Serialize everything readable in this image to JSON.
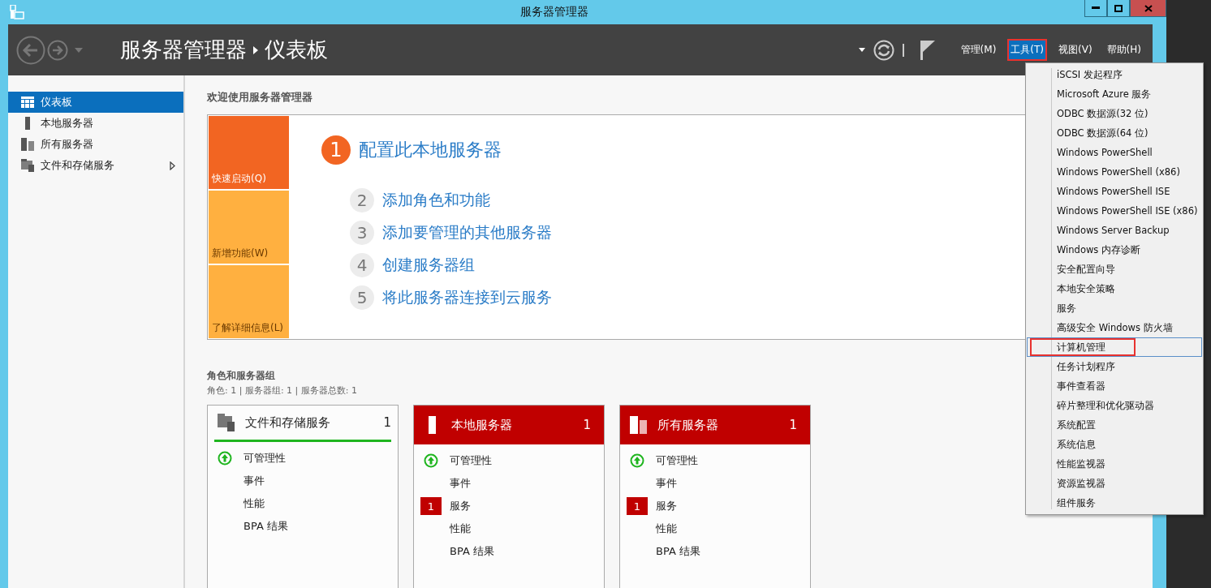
{
  "window": {
    "title": "服务器管理器"
  },
  "breadcrumb": {
    "root": "服务器管理器",
    "current": "仪表板"
  },
  "menubar": [
    {
      "label": "管理(M)",
      "selected": false,
      "annotated": false
    },
    {
      "label": "工具(T)",
      "selected": true,
      "annotated": true
    },
    {
      "label": "视图(V)",
      "selected": false,
      "annotated": false
    },
    {
      "label": "帮助(H)",
      "selected": false,
      "annotated": false
    }
  ],
  "sidebar": {
    "items": [
      {
        "label": "仪表板",
        "kind": "dashboard",
        "selected": true,
        "has_submenu": false
      },
      {
        "label": "本地服务器",
        "kind": "server",
        "selected": false,
        "has_submenu": false
      },
      {
        "label": "所有服务器",
        "kind": "servers",
        "selected": false,
        "has_submenu": false
      },
      {
        "label": "文件和存储服务",
        "kind": "files",
        "selected": false,
        "has_submenu": true
      }
    ]
  },
  "welcome": {
    "title": "欢迎使用服务器管理器",
    "tiles": [
      {
        "label": "快速启动(Q)",
        "selected": true
      },
      {
        "label": "新增功能(W)",
        "selected": false
      },
      {
        "label": "了解详细信息(L)",
        "selected": false
      }
    ],
    "steps": [
      {
        "number": "1",
        "label": "配置此本地服务器",
        "selected": true
      },
      {
        "number": "2",
        "label": "添加角色和功能",
        "selected": false
      },
      {
        "number": "3",
        "label": "添加要管理的其他服务器",
        "selected": false
      },
      {
        "number": "4",
        "label": "创建服务器组",
        "selected": false
      },
      {
        "number": "5",
        "label": "将此服务器连接到云服务",
        "selected": false
      }
    ]
  },
  "roles": {
    "title": "角色和服务器组",
    "summary": "角色: 1 | 服务器组: 1 | 服务器总数: 1",
    "cards": [
      {
        "title": "文件和存储服务",
        "count": "1",
        "kind": "files",
        "alert": false,
        "rows": [
          {
            "label": "可管理性",
            "healthy": true
          },
          {
            "label": "事件"
          },
          {
            "label": "性能"
          },
          {
            "label": "BPA 结果"
          }
        ]
      },
      {
        "title": "本地服务器",
        "count": "1",
        "kind": "server",
        "alert": true,
        "rows": [
          {
            "label": "可管理性",
            "healthy": true
          },
          {
            "label": "事件"
          },
          {
            "label": "服务",
            "badge": "1"
          },
          {
            "label": "性能"
          },
          {
            "label": "BPA 结果"
          }
        ]
      },
      {
        "title": "所有服务器",
        "count": "1",
        "kind": "servers",
        "alert": true,
        "rows": [
          {
            "label": "可管理性",
            "healthy": true
          },
          {
            "label": "事件"
          },
          {
            "label": "服务",
            "badge": "1"
          },
          {
            "label": "性能"
          },
          {
            "label": "BPA 结果"
          }
        ]
      }
    ]
  },
  "tools_menu": {
    "items": [
      {
        "label": "iSCSI 发起程序",
        "selected": false,
        "annotated": false
      },
      {
        "label": "Microsoft Azure 服务",
        "selected": false,
        "annotated": false
      },
      {
        "label": "ODBC 数据源(32 位)",
        "selected": false,
        "annotated": false
      },
      {
        "label": "ODBC 数据源(64 位)",
        "selected": false,
        "annotated": false
      },
      {
        "label": "Windows PowerShell",
        "selected": false,
        "annotated": false
      },
      {
        "label": "Windows PowerShell (x86)",
        "selected": false,
        "annotated": false
      },
      {
        "label": "Windows PowerShell ISE",
        "selected": false,
        "annotated": false
      },
      {
        "label": "Windows PowerShell ISE (x86)",
        "selected": false,
        "annotated": false
      },
      {
        "label": "Windows Server Backup",
        "selected": false,
        "annotated": false
      },
      {
        "label": "Windows 内存诊断",
        "selected": false,
        "annotated": false
      },
      {
        "label": "安全配置向导",
        "selected": false,
        "annotated": false
      },
      {
        "label": "本地安全策略",
        "selected": false,
        "annotated": false
      },
      {
        "label": "服务",
        "selected": false,
        "annotated": false
      },
      {
        "label": "高级安全 Windows 防火墙",
        "selected": false,
        "annotated": false
      },
      {
        "label": "计算机管理",
        "selected": true,
        "annotated": true
      },
      {
        "label": "任务计划程序",
        "selected": false,
        "annotated": false
      },
      {
        "label": "事件查看器",
        "selected": false,
        "annotated": false
      },
      {
        "label": "碎片整理和优化驱动器",
        "selected": false,
        "annotated": false
      },
      {
        "label": "系统配置",
        "selected": false,
        "annotated": false
      },
      {
        "label": "系统信息",
        "selected": false,
        "annotated": false
      },
      {
        "label": "性能监视器",
        "selected": false,
        "annotated": false
      },
      {
        "label": "资源监视器",
        "selected": false,
        "annotated": false
      },
      {
        "label": "组件服务",
        "selected": false,
        "annotated": false
      }
    ]
  }
}
